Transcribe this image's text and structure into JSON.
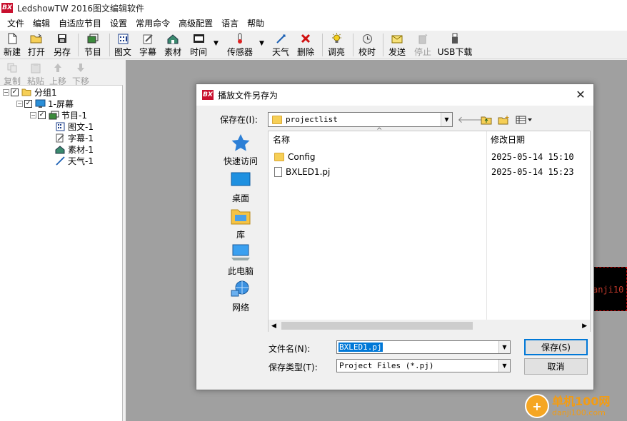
{
  "app": {
    "title": "LedshowTW 2016图文编辑软件",
    "logo": "BX"
  },
  "menu": [
    "文件",
    "编辑",
    "自适应节目",
    "设置",
    "常用命令",
    "高级配置",
    "语言",
    "帮助"
  ],
  "toolbar": {
    "new": "新建",
    "open": "打开",
    "save_as": "另存",
    "program": "节目",
    "graphic_text": "图文",
    "subtitle": "字幕",
    "material": "素材",
    "time": "时间",
    "sensor": "传感器",
    "weather": "天气",
    "delete": "删除",
    "brightness": "调亮",
    "calibrate": "校时",
    "send": "发送",
    "stop": "停止",
    "usb_download": "USB下载"
  },
  "edit_bar": {
    "copy": "复制",
    "paste": "粘贴",
    "move_up": "上移",
    "move_down": "下移"
  },
  "tree": {
    "group": "分组1",
    "screen": "1-屏幕",
    "program": "节目-1",
    "items": [
      "图文-1",
      "字幕-1",
      "素材-1",
      "天气-1"
    ]
  },
  "led_preview_text": "anji10",
  "watermark": {
    "line1": "单机100网",
    "line2": "danji100.com"
  },
  "dialog": {
    "title": "播放文件另存为",
    "look_in_label": "保存在(I):",
    "look_in_value": "projectlist",
    "places": [
      "快速访问",
      "桌面",
      "库",
      "此电脑",
      "网络"
    ],
    "columns": {
      "name": "名称",
      "modified": "修改日期"
    },
    "files": [
      {
        "name": "Config",
        "type": "folder",
        "modified": "2025-05-14 15:10"
      },
      {
        "name": "BXLED1.pj",
        "type": "file",
        "modified": "2025-05-14 15:23"
      }
    ],
    "filename_label": "文件名(N):",
    "filename_value": "BXLED1.pj",
    "filetype_label": "保存类型(T):",
    "filetype_value": "Project Files (*.pj)",
    "save_button": "保存(S)",
    "cancel_button": "取消"
  }
}
